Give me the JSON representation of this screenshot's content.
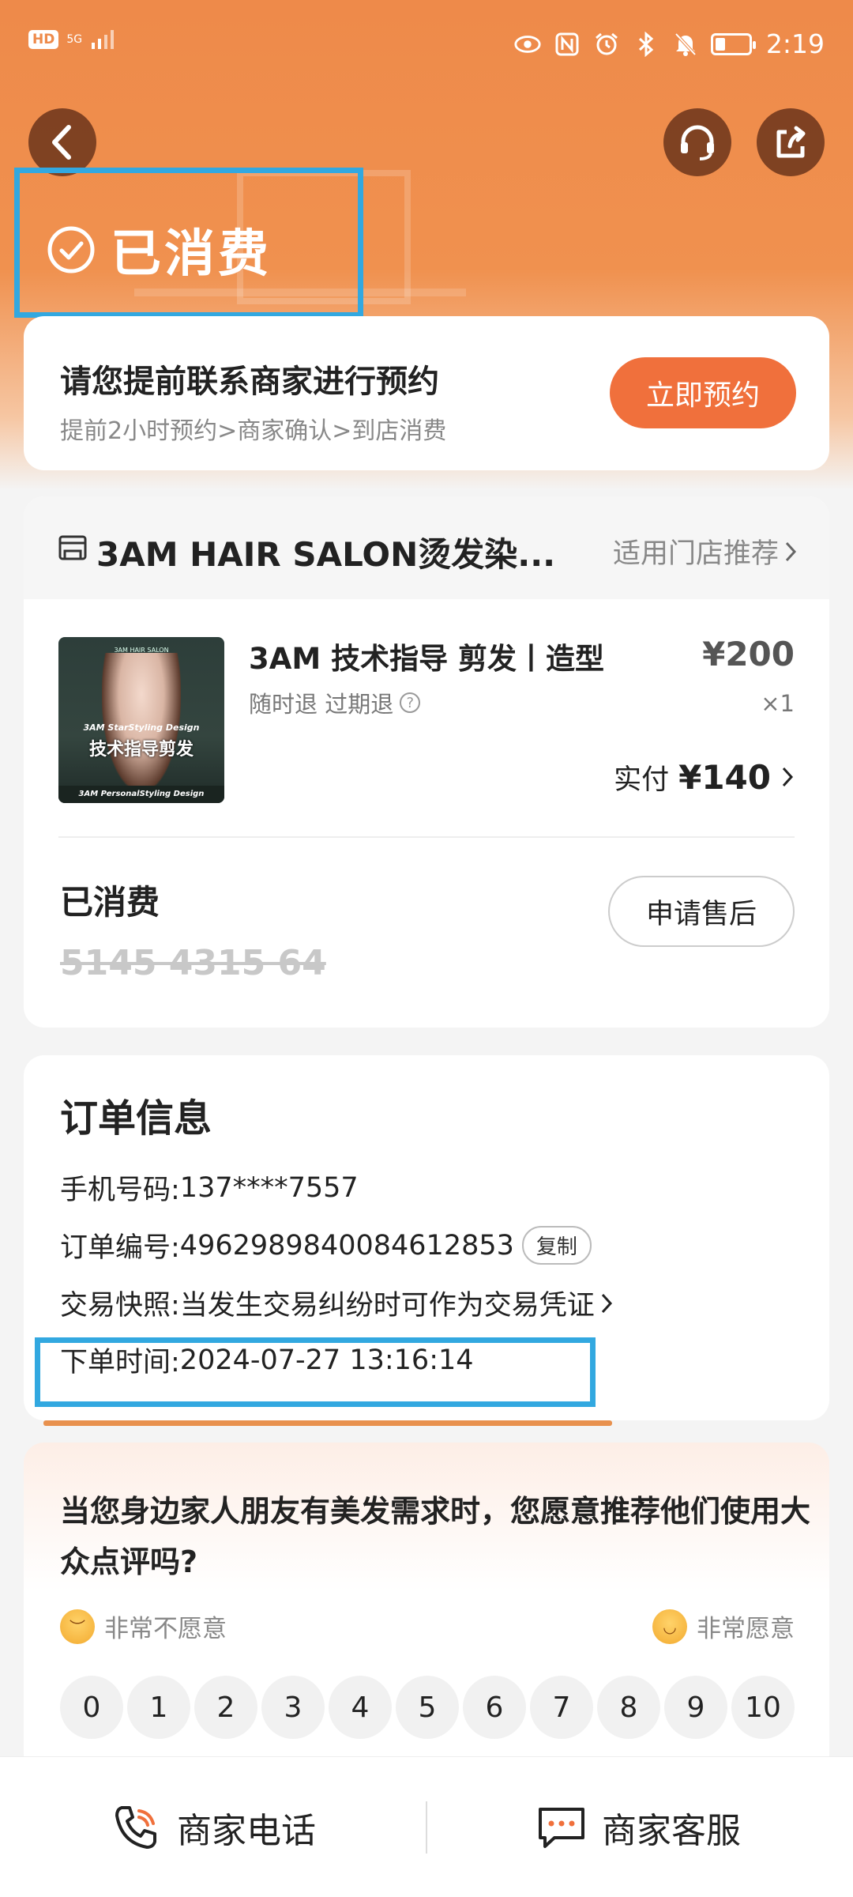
{
  "status_bar": {
    "hd": "HD",
    "signal": "5G",
    "time": "2:19",
    "battery_level": 0.3
  },
  "header": {
    "status_text": "已消费",
    "back_icon": "chevron-left-icon",
    "service_icon": "headset-icon",
    "share_icon": "share-icon"
  },
  "booking": {
    "title": "请您提前联系商家进行预约",
    "steps": "提前2小时预约>商家确认>到店消费",
    "button": "立即预约"
  },
  "shop": {
    "name": "3AM HAIR SALON烫发染...",
    "link": "适用门店推荐"
  },
  "product": {
    "image_brand": "3AM HAIR SALON",
    "image_line1": "3AM StarStyling Design",
    "image_line2": "技术指导剪发",
    "image_line3": "3AM PersonalStyling Design",
    "name": "3AM 技术指导 剪发丨造型",
    "policy": "随时退 过期退",
    "price": "¥200",
    "qty": "×1",
    "paid_label": "实付",
    "paid_amount": "¥140"
  },
  "voucher": {
    "status": "已消费",
    "code": "5145 4315 64",
    "after_sale": "申请售后"
  },
  "order": {
    "title": "订单信息",
    "phone_label": "手机号码:",
    "phone": "137****7557",
    "no_label": "订单编号:",
    "no": "4962989840084612853",
    "copy": "复制",
    "snapshot_label": "交易快照:",
    "snapshot": "当发生交易纠纷时可作为交易凭证",
    "time_label": "下单时间:",
    "time": "2024-07-27 13:16:14"
  },
  "survey": {
    "question": "当您身边家人朋友有美发需求时，您愿意推荐他们使用大众点评吗?",
    "low": "非常不愿意",
    "high": "非常愿意",
    "scores": [
      "0",
      "1",
      "2",
      "3",
      "4",
      "5",
      "6",
      "7",
      "8",
      "9",
      "10"
    ]
  },
  "bottom": {
    "call": "商家电话",
    "chat": "商家客服"
  },
  "colors": {
    "accent": "#f0703c",
    "header": "#ee8a4a",
    "highlight": "#32a8e0"
  }
}
